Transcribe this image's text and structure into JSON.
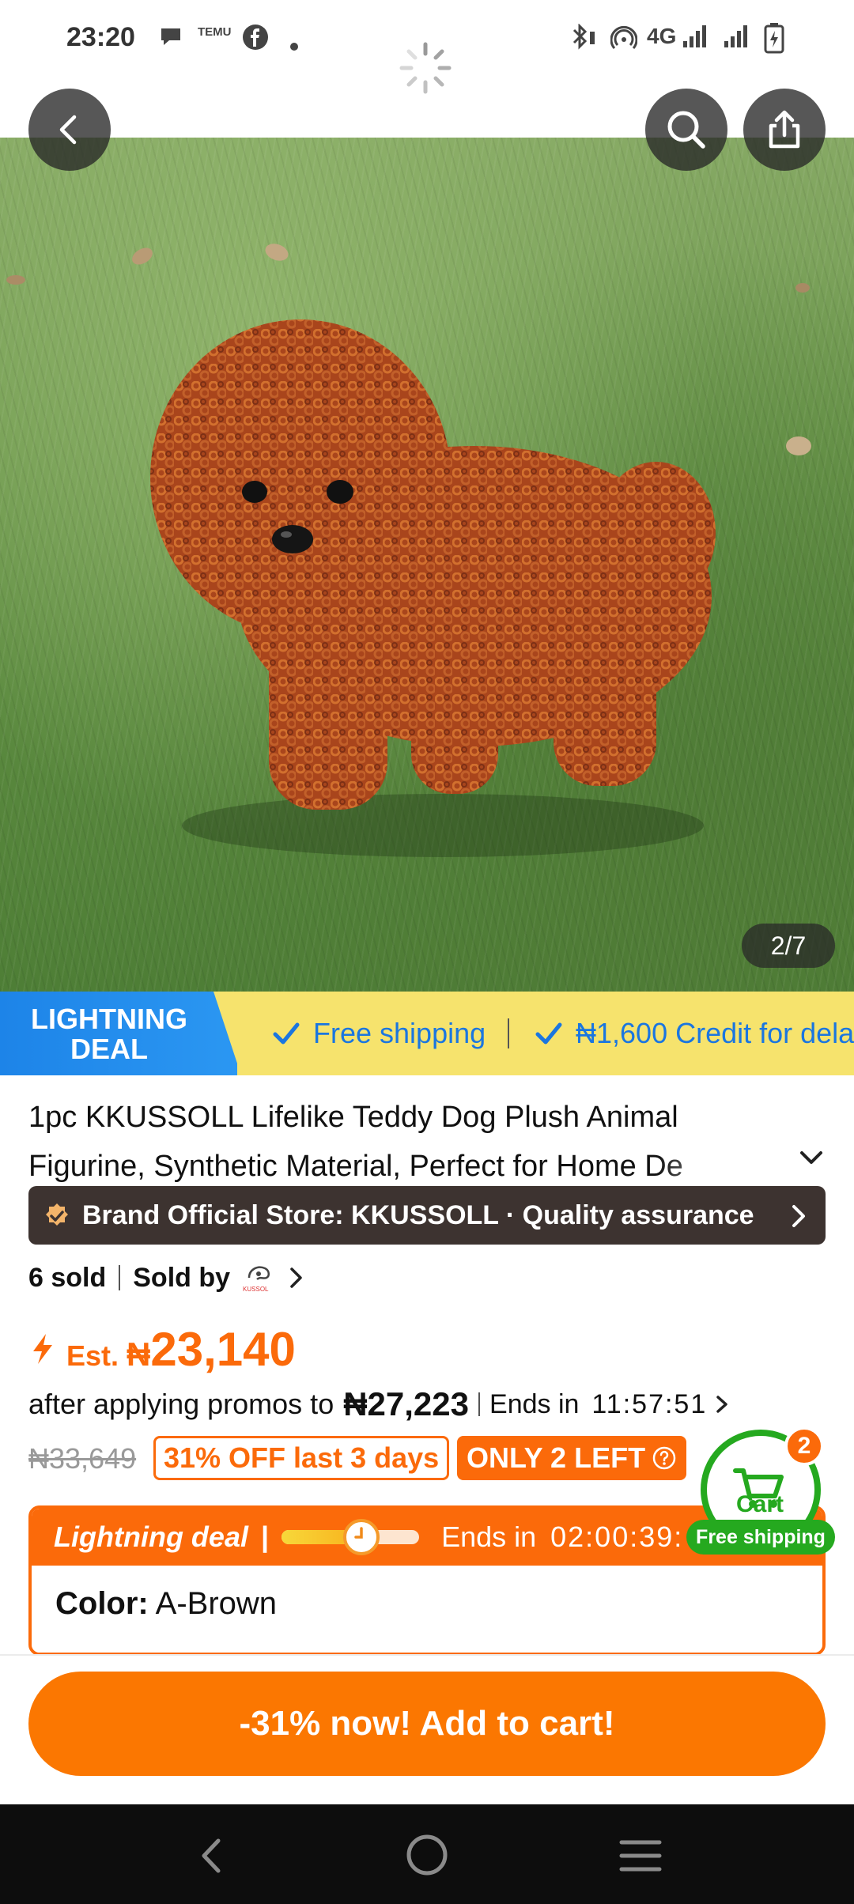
{
  "status_bar": {
    "time": "23:20",
    "temu_label": "TEMU",
    "network": "4G",
    "icons": [
      "chat-icon",
      "temu-icon",
      "facebook-icon",
      "dot-icon",
      "bluetooth-icon",
      "hotspot-icon",
      "signal-icon",
      "battery-icon"
    ]
  },
  "nav": {
    "back_icon": "back-icon",
    "search_icon": "search-icon",
    "share_icon": "share-icon"
  },
  "gallery": {
    "counter": "2/7"
  },
  "banner": {
    "tag_line1": "LIGHTNING",
    "tag_line2": "DEAL",
    "free_shipping": "Free shipping",
    "credit": "₦1,600 Credit for dela"
  },
  "product": {
    "title_line1": "1pc KKUSSOLL Lifelike Teddy Dog Plush Animal",
    "title_line2": "Figurine, Synthetic Material, Perfect for Home De"
  },
  "brand_bar": {
    "text": "Brand Official Store: KKUSSOLL · Quality assurance"
  },
  "sales": {
    "sold": "6 sold",
    "sold_by": "Sold by",
    "seller_logo": "KUSSOL"
  },
  "price": {
    "est_label": "Est.",
    "currency": "₦",
    "amount": "23,140",
    "promo_prefix": "after applying promos to",
    "promo_price": "₦27,223",
    "ends_label": "Ends in",
    "ends_time": "11:57:51",
    "original": "₦33,649",
    "off_badge": "31% OFF last 3 days",
    "stock_badge": "ONLY 2 LEFT"
  },
  "deal": {
    "label": "Lightning deal",
    "ends_label": "Ends in",
    "ends_time": "02:00:39:",
    "progress": 0.58,
    "color_label": "Color:",
    "color_value": "A-Brown"
  },
  "cart": {
    "count": "2",
    "label": "Cart",
    "free_shipping": "Free shipping"
  },
  "cta": {
    "label": "-31% now! Add to cart!"
  },
  "colors": {
    "accent": "#fb7701",
    "banner_yellow": "#f6e36d",
    "banner_blue": "#1d84e8",
    "cart_green": "#25a91f"
  }
}
